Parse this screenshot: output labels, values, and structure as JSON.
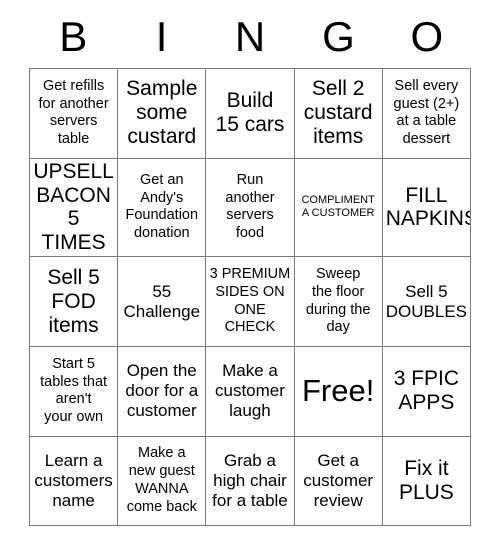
{
  "card": {
    "title_letters": [
      "B",
      "I",
      "N",
      "G",
      "O"
    ],
    "rows": [
      [
        {
          "text": "Get refills\nfor another\nservers\ntable",
          "size": "t-sm"
        },
        {
          "text": "Sample\nsome\ncustard",
          "size": "t-lg"
        },
        {
          "text": "Build\n15 cars",
          "size": "t-lg"
        },
        {
          "text": "Sell 2\ncustard\nitems",
          "size": "t-lg"
        },
        {
          "text": "Sell every\nguest (2+)\nat a table\ndessert",
          "size": "t-sm"
        }
      ],
      [
        {
          "text": "UPSELL\nBACON\n5 TIMES",
          "size": "t-lg"
        },
        {
          "text": "Get an\nAndy's\nFoundation\ndonation",
          "size": "t-sm"
        },
        {
          "text": "Run\nanother\nservers\nfood",
          "size": "t-sm"
        },
        {
          "text": "COMPLIMENT\nA CUSTOMER",
          "size": "t-xs"
        },
        {
          "text": "FILL\nNAPKINS",
          "size": "t-lg"
        }
      ],
      [
        {
          "text": "Sell 5\nFOD\nitems",
          "size": "t-lg"
        },
        {
          "text": "55\nChallenge",
          "size": "t-md"
        },
        {
          "text": "3 PREMIUM\nSIDES ON\nONE\nCHECK",
          "size": "t-sm"
        },
        {
          "text": "Sweep\nthe floor\nduring the\nday",
          "size": "t-sm"
        },
        {
          "text": "Sell 5\nDOUBLES",
          "size": "t-md"
        }
      ],
      [
        {
          "text": "Start 5\ntables that\naren't\nyour own",
          "size": "t-sm"
        },
        {
          "text": "Open the\ndoor for a\ncustomer",
          "size": "t-md"
        },
        {
          "text": "Make a\ncustomer\nlaugh",
          "size": "t-md"
        },
        {
          "text": "Free!",
          "size": "t-xl"
        },
        {
          "text": "3 FPIC\nAPPS",
          "size": "t-lg"
        }
      ],
      [
        {
          "text": "Learn a\ncustomers\nname",
          "size": "t-md"
        },
        {
          "text": "Make a\nnew guest\nWANNA\ncome back",
          "size": "t-sm"
        },
        {
          "text": "Grab a\nhigh chair\nfor a table",
          "size": "t-md"
        },
        {
          "text": "Get a\ncustomer\nreview",
          "size": "t-md"
        },
        {
          "text": "Fix it\nPLUS",
          "size": "t-lg"
        }
      ]
    ]
  },
  "colors": {
    "background": "#ffffff",
    "text": "#000000",
    "grid_line": "#7a7a7a"
  }
}
